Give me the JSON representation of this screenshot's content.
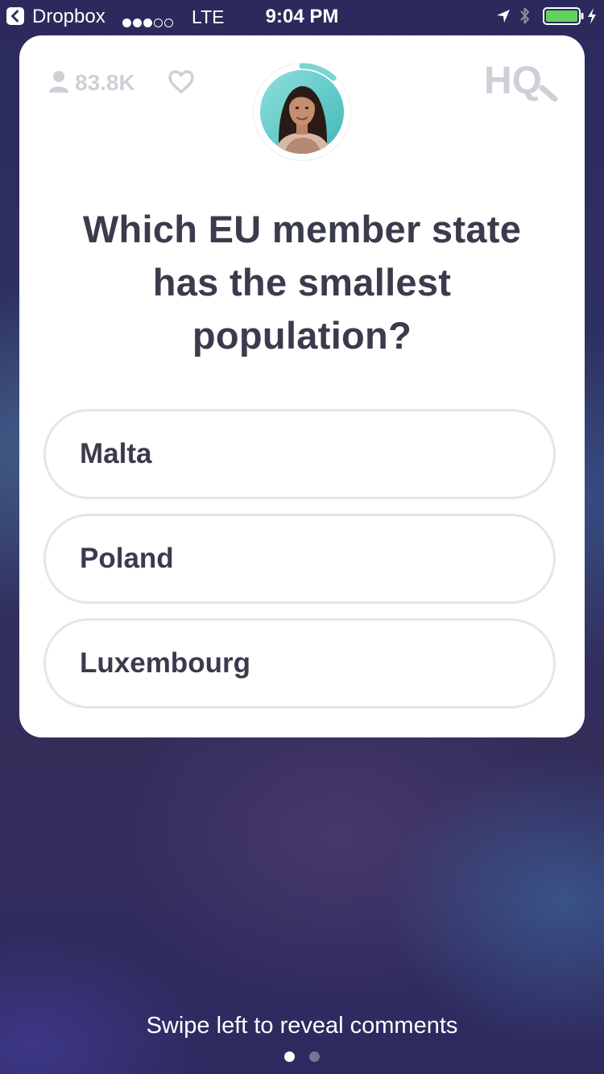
{
  "status_bar": {
    "back_app": "Dropbox",
    "signal_filled": 3,
    "signal_total": 5,
    "carrier": "LTE",
    "time": "9:04 PM",
    "icons": [
      "back-icon",
      "location-icon",
      "bluetooth-icon",
      "battery-icon",
      "charging-icon"
    ],
    "battery_level": 1.0,
    "battery_color": "#5fd35a"
  },
  "card": {
    "viewer_count": "83.8K",
    "icons": [
      "person-icon",
      "heart-icon",
      "hq-logo"
    ],
    "logo_text": "HQ",
    "question": "Which EU member state has the smallest population?",
    "answers": [
      {
        "label": "Malta"
      },
      {
        "label": "Poland"
      },
      {
        "label": "Luxembourg"
      }
    ],
    "timer_color": "#7ad6d0"
  },
  "footer": {
    "hint": "Swipe left to reveal comments",
    "pages": 2,
    "active_page": 1
  },
  "colors": {
    "text_dark": "#3a3b4c",
    "muted": "#cfd0d7",
    "answer_border": "#e6e6e9",
    "background": "#2f3163"
  }
}
